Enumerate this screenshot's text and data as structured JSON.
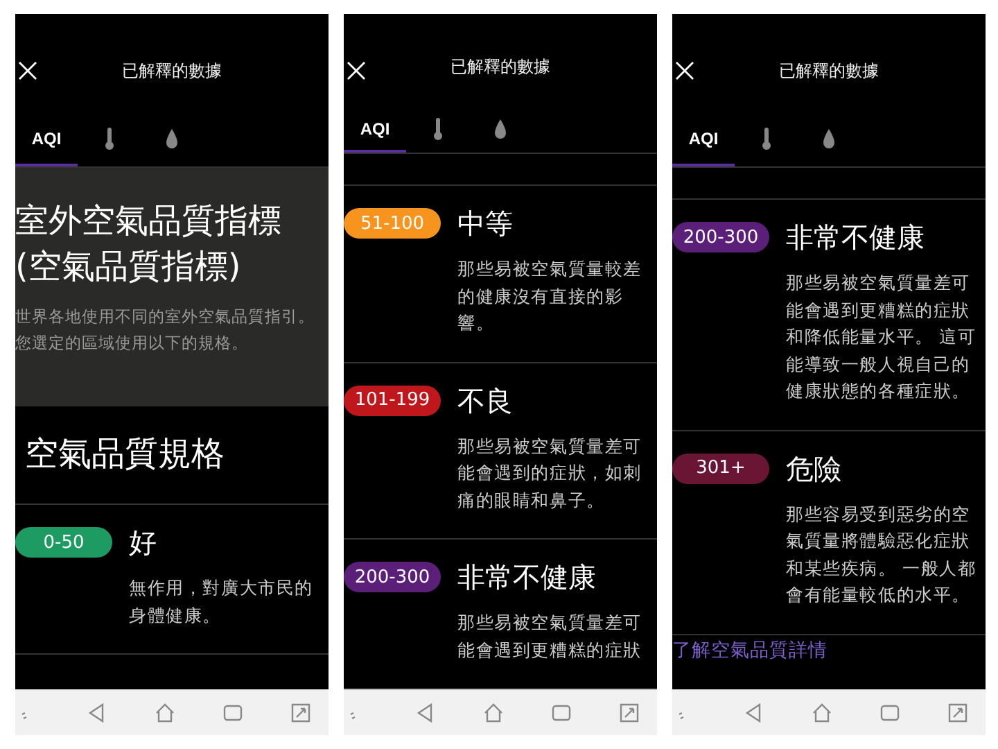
{
  "panels": [
    {
      "title": "已解釋的數據",
      "tabs": [
        {
          "kind": "text",
          "label": "AQI",
          "selected": true
        },
        {
          "kind": "thermometer",
          "selected": false
        },
        {
          "kind": "drop",
          "selected": false
        }
      ],
      "blocks": [
        {
          "kind": "intro",
          "heading": "室外空氣品質指標(空氣品質指標)",
          "text": "世界各地使用不同的室外空氣品質指引。您選定的區域使用以下的規格。"
        },
        {
          "kind": "heading",
          "text": "空氣品質規格"
        },
        {
          "kind": "level",
          "range": "0-50",
          "color": "#1e9a63",
          "title": "好",
          "text": "無作用，對廣大市民的身體健康。"
        }
      ]
    },
    {
      "title": "已解釋的數據",
      "tabs": [
        {
          "kind": "text",
          "label": "AQI",
          "selected": true
        },
        {
          "kind": "thermometer",
          "selected": false
        },
        {
          "kind": "drop",
          "selected": false
        }
      ],
      "blocks": [
        {
          "kind": "level",
          "range": "51-100",
          "color": "#f7941d",
          "title": "中等",
          "text": "那些易被空氣質量較差的健康沒有直接的影響。"
        },
        {
          "kind": "level",
          "range": "101-199",
          "color": "#c0171c",
          "title": "不良",
          "text": "那些易被空氣質量差可能會遇到的症狀，如刺痛的眼睛和鼻子。"
        },
        {
          "kind": "level",
          "range": "200-300",
          "color": "#5b1f7a",
          "title": "非常不健康",
          "text": "那些易被空氣質量差可能會遇到更糟糕的症狀"
        }
      ]
    },
    {
      "title": "已解釋的數據",
      "tabs": [
        {
          "kind": "text",
          "label": "AQI",
          "selected": true
        },
        {
          "kind": "thermometer",
          "selected": false
        },
        {
          "kind": "drop",
          "selected": false
        }
      ],
      "blocks": [
        {
          "kind": "level",
          "range": "200-300",
          "color": "#5b1f7a",
          "title": "非常不健康",
          "text": "那些易被空氣質量差可能會遇到更糟糕的症狀和降低能量水平。 這可能導致一般人視自己的健康狀態的各種症狀。"
        },
        {
          "kind": "level",
          "range": "301+",
          "color": "#6b1535",
          "title": "危險",
          "text": "那些容易受到惡劣的空氣質量將體驗惡化症狀和某些疾病。 一般人都會有能量較低的水平。"
        },
        {
          "kind": "link",
          "text": "了解空氣品質詳情"
        }
      ]
    }
  ]
}
